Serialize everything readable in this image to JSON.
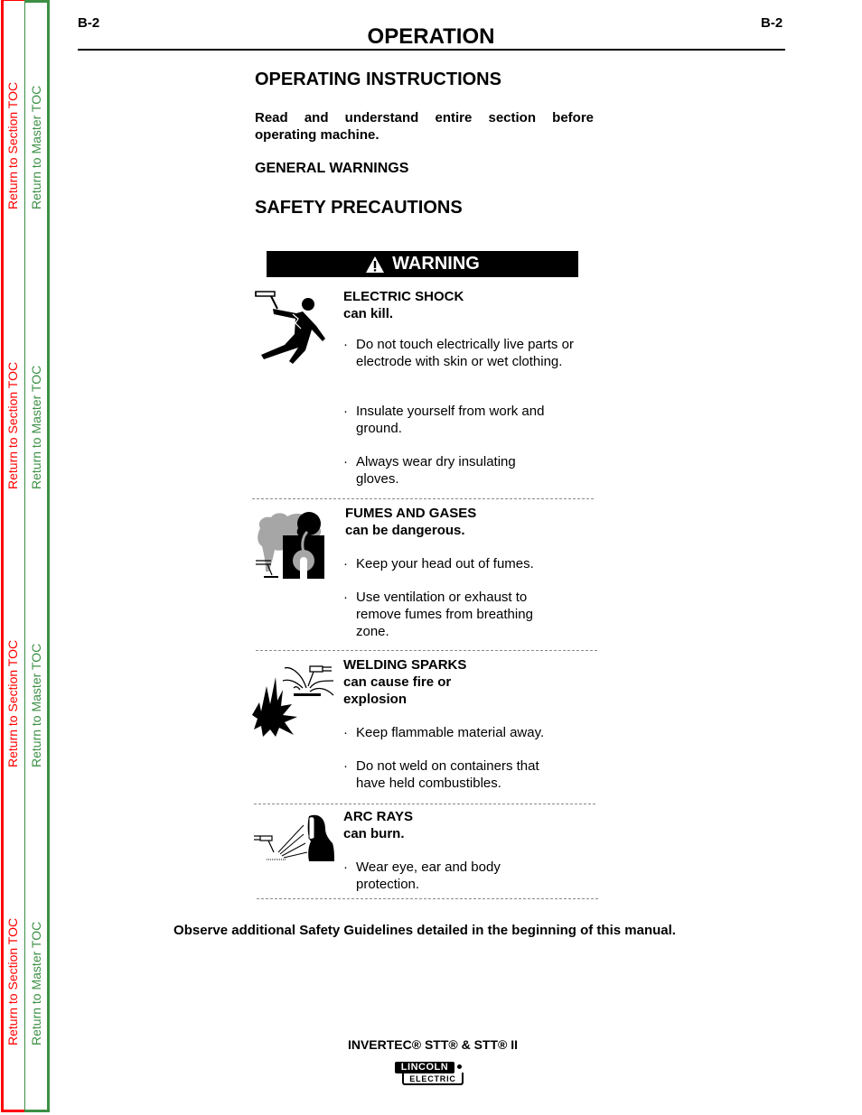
{
  "toc": {
    "section_label": "Return to Section TOC",
    "master_label": "Return to Master TOC",
    "section_color": "#ff0000",
    "master_color": "#3c8f45"
  },
  "header": {
    "page_code_left": "B-2",
    "page_code_right": "B-2",
    "section_title": "OPERATION"
  },
  "content": {
    "heading_operating": "OPERATING INSTRUCTIONS",
    "intro": "Read and understand entire section before operating machine.",
    "heading_general": "GENERAL WARNINGS",
    "heading_safety": "SAFETY PRECAUTIONS",
    "warning_label": "WARNING",
    "hazards": [
      {
        "icon": "electric-shock-icon",
        "title_line1": "ELECTRIC SHOCK",
        "title_line2": "can kill.",
        "bullets": [
          "Do not touch electrically live parts or electrode with skin or wet clothing.",
          "Insulate yourself from work and ground.",
          "Always wear dry insulating gloves."
        ]
      },
      {
        "icon": "fumes-gases-icon",
        "title_line1": "FUMES AND GASES",
        "title_line2": "can be dangerous.",
        "bullets": [
          "Keep your head out of fumes.",
          "Use ventilation or exhaust to remove fumes from breathing zone."
        ]
      },
      {
        "icon": "welding-sparks-icon",
        "title_line1": "WELDING SPARKS",
        "title_line2": "can cause fire or",
        "title_line3": "explosion",
        "bullets": [
          "Keep flammable material away.",
          "Do not weld on containers that have held combustibles."
        ]
      },
      {
        "icon": "arc-rays-icon",
        "title_line1": "ARC RAYS",
        "title_line2": "can burn.",
        "bullets": [
          "Wear eye, ear and body protection."
        ]
      }
    ],
    "bullet_glyph": "·"
  },
  "footer": {
    "note": "Observe additional Safety Guidelines detailed in the beginning of this manual.",
    "product": "INVERTEC® STT® & STT® II",
    "logo_top": "LINCOLN",
    "logo_bottom": "ELECTRIC"
  }
}
